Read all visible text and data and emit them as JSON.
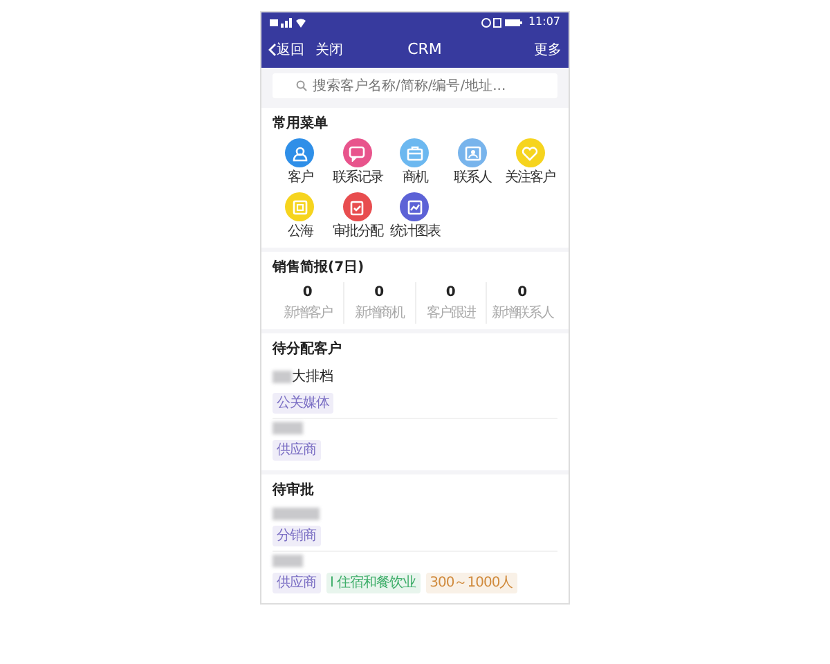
{
  "status_bar": {
    "time": "11:07"
  },
  "nav": {
    "back": "返回",
    "close": "关闭",
    "title": "CRM",
    "more": "更多"
  },
  "search": {
    "placeholder": "搜索客户名称/简称/编号/地址..."
  },
  "menu": {
    "title": "常用菜单",
    "items": [
      {
        "label": "客户",
        "color": "#2f8fe8"
      },
      {
        "label": "联系记录",
        "color": "#e8548c"
      },
      {
        "label": "商机",
        "color": "#6cb8f0"
      },
      {
        "label": "联系人",
        "color": "#78b4ec"
      },
      {
        "label": "关注客户",
        "color": "#f6d41e"
      },
      {
        "label": "公海",
        "color": "#f6d41e"
      },
      {
        "label": "审批分配",
        "color": "#e84d4f"
      },
      {
        "label": "统计图表",
        "color": "#5c62d6"
      }
    ]
  },
  "sales": {
    "title": "销售简报(7日)",
    "stats": [
      {
        "value": "0",
        "label": "新增客户"
      },
      {
        "value": "0",
        "label": "新增商机"
      },
      {
        "value": "0",
        "label": "客户跟进"
      },
      {
        "value": "0",
        "label": "新增联系人"
      }
    ]
  },
  "pending_customers": {
    "title": "待分配客户",
    "items": [
      {
        "name": "大排档",
        "tags": [
          {
            "label": "公关媒体",
            "color": "#7b6fc4"
          }
        ]
      },
      {
        "tags": [
          {
            "label": "供应商",
            "color": "#7b6fc4"
          }
        ]
      }
    ]
  },
  "pending_approvals": {
    "title": "待审批",
    "items": [
      {
        "tags": [
          {
            "label": "分销商",
            "color": "#7b6fc4"
          }
        ]
      },
      {
        "tags": [
          {
            "label": "供应商",
            "color": "#7b6fc4"
          },
          {
            "label": "I 住宿和餐饮业",
            "color": "#3fae6a"
          },
          {
            "label": "300～1000人",
            "color": "#d08a3c"
          }
        ]
      }
    ]
  }
}
